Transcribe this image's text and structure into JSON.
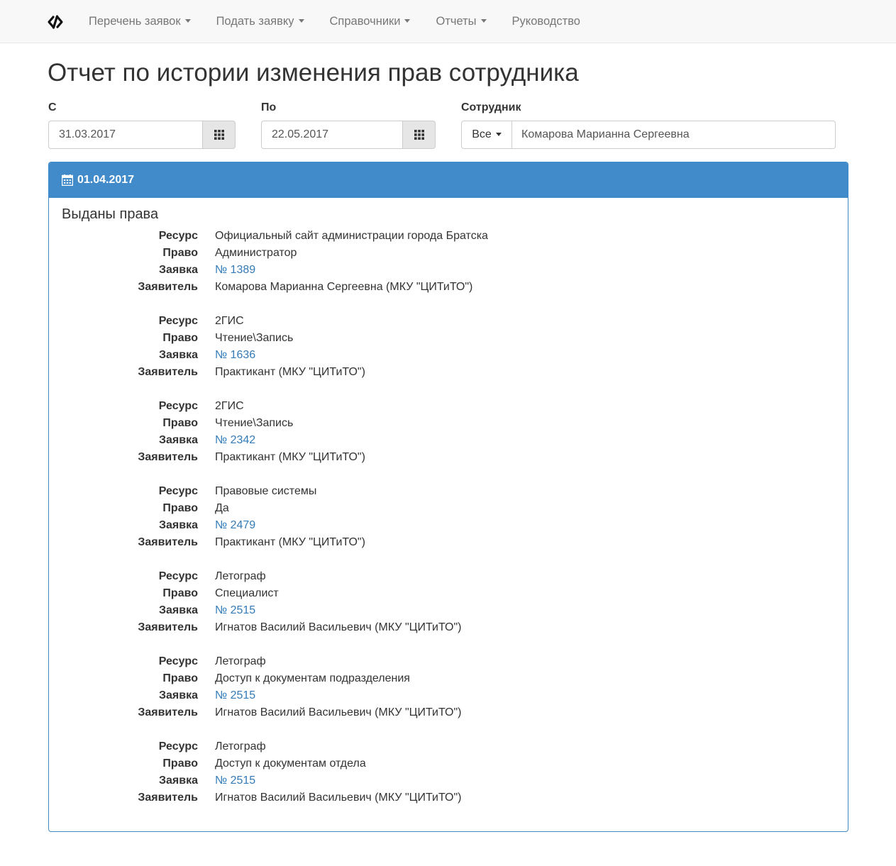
{
  "nav": {
    "items": [
      {
        "label": "Перечень заявок",
        "dropdown": true
      },
      {
        "label": "Подать заявку",
        "dropdown": true
      },
      {
        "label": "Справочники",
        "dropdown": true
      },
      {
        "label": "Отчеты",
        "dropdown": true
      },
      {
        "label": "Руководство",
        "dropdown": false
      }
    ]
  },
  "page": {
    "title": "Отчет по истории изменения прав сотрудника"
  },
  "filters": {
    "from_label": "С",
    "from_value": "31.03.2017",
    "to_label": "По",
    "to_value": "22.05.2017",
    "employee_label": "Сотрудник",
    "employee_scope": "Все",
    "employee_value": "Комарова Марианна Сергеевна"
  },
  "panel": {
    "date": "01.04.2017",
    "section_title": "Выданы права",
    "labels": {
      "resource": "Ресурс",
      "right": "Право",
      "request": "Заявка",
      "applicant": "Заявитель"
    },
    "records": [
      {
        "resource": "Официальный сайт администрации города Братска",
        "right": "Администратор",
        "request": "№ 1389",
        "applicant": "Комарова Марианна Сергеевна (МКУ \"ЦИТиТО\")"
      },
      {
        "resource": "2ГИС",
        "right": "Чтение\\Запись",
        "request": "№ 1636",
        "applicant": "Практикант (МКУ \"ЦИТиТО\")"
      },
      {
        "resource": "2ГИС",
        "right": "Чтение\\Запись",
        "request": "№ 2342",
        "applicant": "Практикант (МКУ \"ЦИТиТО\")"
      },
      {
        "resource": "Правовые системы",
        "right": "Да",
        "request": "№ 2479",
        "applicant": "Практикант (МКУ \"ЦИТиТО\")"
      },
      {
        "resource": "Летограф",
        "right": "Специалист",
        "request": "№ 2515",
        "applicant": "Игнатов Василий Васильевич (МКУ \"ЦИТиТО\")"
      },
      {
        "resource": "Летограф",
        "right": "Доступ к документам подразделения",
        "request": "№ 2515",
        "applicant": "Игнатов Василий Васильевич (МКУ \"ЦИТиТО\")"
      },
      {
        "resource": "Летограф",
        "right": "Доступ к документам отдела",
        "request": "№ 2515",
        "applicant": "Игнатов Василий Васильевич (МКУ \"ЦИТиТО\")"
      }
    ]
  },
  "colors": {
    "primary": "#428bca",
    "link": "#337ab7",
    "navbar_bg": "#f8f8f8",
    "nav_text": "#777777"
  }
}
